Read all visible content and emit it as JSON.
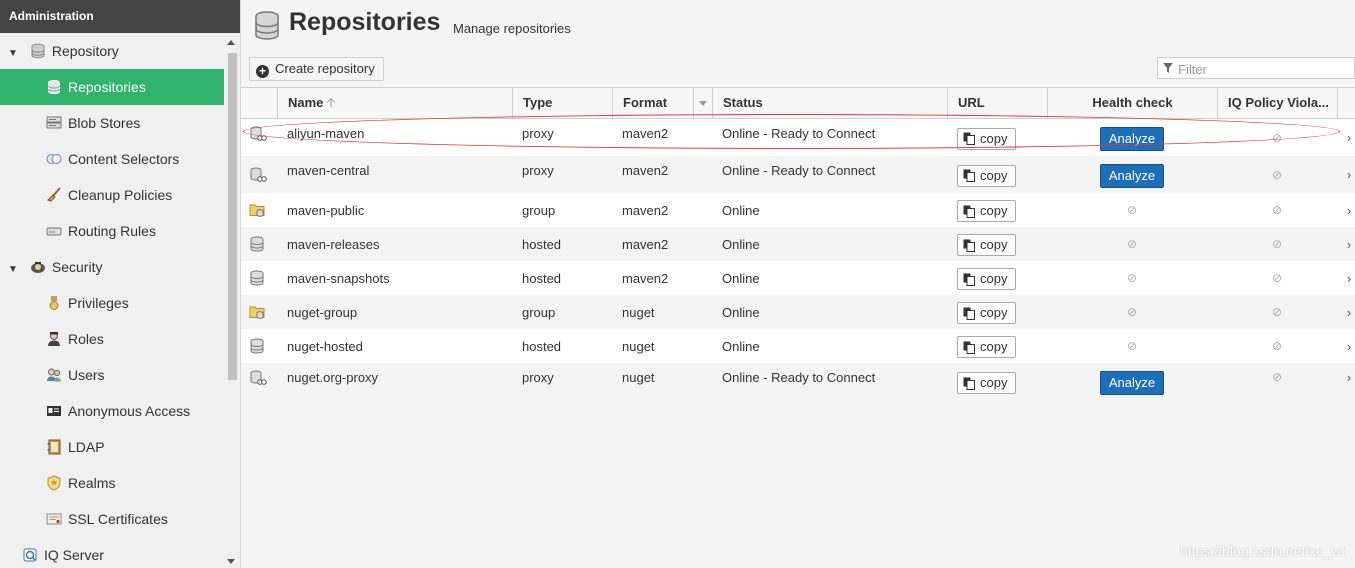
{
  "sidebar": {
    "header": "Administration",
    "items": [
      {
        "label": "Repository",
        "icon": "database-icon",
        "type": "group"
      },
      {
        "label": "Repositories",
        "icon": "database-icon",
        "type": "child",
        "active": true
      },
      {
        "label": "Blob Stores",
        "icon": "server-icon",
        "type": "child"
      },
      {
        "label": "Content Selectors",
        "icon": "circles-icon",
        "type": "child"
      },
      {
        "label": "Cleanup Policies",
        "icon": "brush-icon",
        "type": "child"
      },
      {
        "label": "Routing Rules",
        "icon": "drive-icon",
        "type": "child"
      },
      {
        "label": "Security",
        "icon": "security-badge-icon",
        "type": "group"
      },
      {
        "label": "Privileges",
        "icon": "medal-icon",
        "type": "child"
      },
      {
        "label": "Roles",
        "icon": "user-role-icon",
        "type": "child"
      },
      {
        "label": "Users",
        "icon": "users-icon",
        "type": "child"
      },
      {
        "label": "Anonymous Access",
        "icon": "id-card-icon",
        "type": "child"
      },
      {
        "label": "LDAP",
        "icon": "address-book-icon",
        "type": "child"
      },
      {
        "label": "Realms",
        "icon": "shield-icon",
        "type": "child"
      },
      {
        "label": "SSL Certificates",
        "icon": "certificate-icon",
        "type": "child"
      },
      {
        "label": "IQ Server",
        "icon": "iq-server-icon",
        "type": "group"
      }
    ]
  },
  "page": {
    "title": "Repositories",
    "subtitle": "Manage repositories",
    "create_label": "Create repository",
    "filter_placeholder": "Filter"
  },
  "table": {
    "columns": {
      "name": "Name",
      "type": "Type",
      "format": "Format",
      "status": "Status",
      "url": "URL",
      "health": "Health check",
      "iq": "IQ Policy Viola..."
    },
    "copy_label": "copy",
    "analyze_label": "Analyze",
    "rows": [
      {
        "name": "aliyun-maven",
        "type": "proxy",
        "format": "maven2",
        "status": "Online - Ready to Connect",
        "icon": "proxy-icon",
        "analyze": true
      },
      {
        "name": "maven-central",
        "type": "proxy",
        "format": "maven2",
        "status": "Online - Ready to Connect",
        "icon": "proxy-icon",
        "analyze": true
      },
      {
        "name": "maven-public",
        "type": "group",
        "format": "maven2",
        "status": "Online",
        "icon": "folder-group-icon",
        "analyze": false
      },
      {
        "name": "maven-releases",
        "type": "hosted",
        "format": "maven2",
        "status": "Online",
        "icon": "database-icon",
        "analyze": false
      },
      {
        "name": "maven-snapshots",
        "type": "hosted",
        "format": "maven2",
        "status": "Online",
        "icon": "database-icon",
        "analyze": false
      },
      {
        "name": "nuget-group",
        "type": "group",
        "format": "nuget",
        "status": "Online",
        "icon": "folder-group-icon",
        "analyze": false
      },
      {
        "name": "nuget-hosted",
        "type": "hosted",
        "format": "nuget",
        "status": "Online",
        "icon": "database-icon",
        "analyze": false
      },
      {
        "name": "nuget.org-proxy",
        "type": "proxy",
        "format": "nuget",
        "status": "Online - Ready to Connect",
        "icon": "proxy-icon",
        "analyze": true
      }
    ]
  },
  "watermark": "https://blog.csdn.net/xc_wt",
  "colors": {
    "active_nav": "#2fb36d",
    "analyze_button": "#1d6fb9",
    "sidebar_header": "#444444",
    "highlight_ellipse": "#e03a3a"
  }
}
